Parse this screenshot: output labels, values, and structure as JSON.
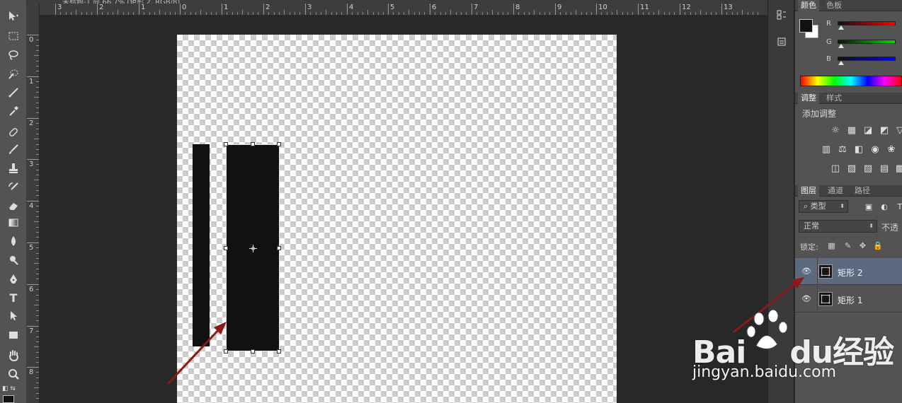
{
  "document": {
    "title_text": "未标题-1 @ 66.7% (矩形 2, RGB/8)"
  },
  "ruler": {
    "top_labels": [
      "3",
      "2",
      "1",
      "0",
      "1",
      "2",
      "3",
      "4",
      "5",
      "6",
      "7",
      "8",
      "9",
      "10",
      "11",
      "12",
      "13"
    ],
    "left_labels": [
      "0",
      "1",
      "2",
      "3",
      "4",
      "5",
      "6",
      "7",
      "8"
    ]
  },
  "toolbar": {
    "tools": [
      "move-tool",
      "marquee-tool",
      "lasso-tool",
      "quick-select-tool",
      "crop-tool",
      "eyedropper-tool",
      "healing-brush-tool",
      "brush-tool",
      "clone-stamp-tool",
      "history-brush-tool",
      "eraser-tool",
      "gradient-tool",
      "blur-tool",
      "dodge-tool",
      "pen-tool",
      "type-tool",
      "path-select-tool",
      "rectangle-tool",
      "hand-tool",
      "zoom-tool"
    ],
    "type_tool_glyph": "T"
  },
  "color_panel": {
    "tabs": [
      "颜色",
      "色板"
    ],
    "channels": [
      "R",
      "G",
      "B"
    ],
    "colors": {
      "foreground": "#111111",
      "background": "#ffffff"
    }
  },
  "adjustments_panel": {
    "tabs": [
      "调整",
      "样式"
    ],
    "title": "添加调整"
  },
  "layers_panel": {
    "tabs": [
      "图层",
      "通道",
      "路径"
    ],
    "filter_label": "类型",
    "blend_mode": "正常",
    "opacity_label": "不透",
    "lock_label": "锁定:",
    "layers": [
      {
        "name": "矩形 2",
        "selected": true
      },
      {
        "name": "矩形 1",
        "selected": false
      }
    ]
  },
  "watermark": {
    "logo_text": "Bai",
    "logo_text2": "du",
    "logo_cn": "经验",
    "url": "jingyan.baidu.com"
  },
  "accent_colors": {
    "selected_layer": "#5c6a80",
    "arrow": "#8b1a1a"
  }
}
